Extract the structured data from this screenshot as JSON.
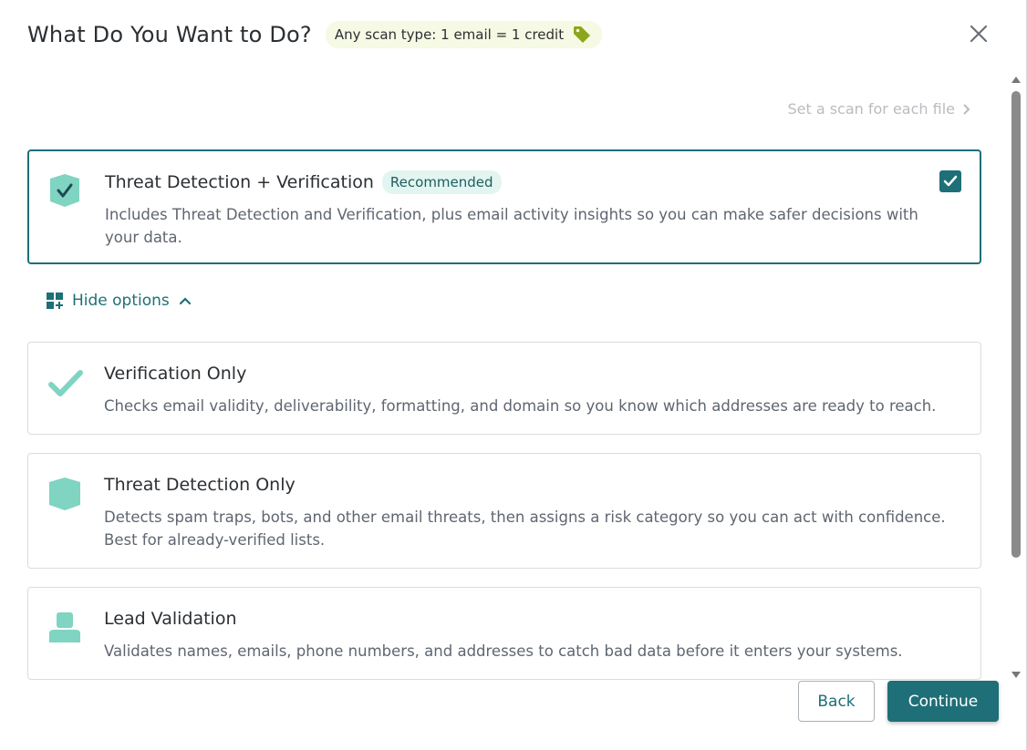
{
  "header": {
    "title": "What Do You Want to Do?",
    "credit_pill": "Any scan type: 1 email = 1 credit",
    "tag_icon": "tag-icon",
    "close_icon": "close-icon"
  },
  "set_scan_link": "Set a scan for each file",
  "options": [
    {
      "name": "Threat Detection + Verification",
      "badge": "Recommended",
      "desc": "Includes Threat Detection and Verification, plus email activity insights so you can make safer decisions with your data.",
      "selected": true,
      "icon": "shield-check-icon"
    },
    {
      "name": "Verification Only",
      "desc": "Checks email validity, deliverability, formatting, and domain so you know which addresses are ready to reach.",
      "selected": false,
      "icon": "checkmark-icon"
    },
    {
      "name": "Threat Detection Only",
      "desc": "Detects spam traps, bots, and other email threats, then assigns a risk category so you can act with confidence. Best for already-verified lists.",
      "selected": false,
      "icon": "shield-icon"
    },
    {
      "name": "Lead Validation",
      "desc": "Validates names, emails, phone numbers, and addresses to catch bad data before it enters your systems.",
      "selected": false,
      "icon": "person-icon"
    }
  ],
  "hide_options": "Hide options",
  "footer": {
    "back": "Back",
    "continue": "Continue"
  },
  "colors": {
    "accent": "#1e6f77",
    "icon_mint": "#7fd4c2",
    "tag_green": "#8aa61c",
    "badge_bg": "#e2f5f1"
  }
}
